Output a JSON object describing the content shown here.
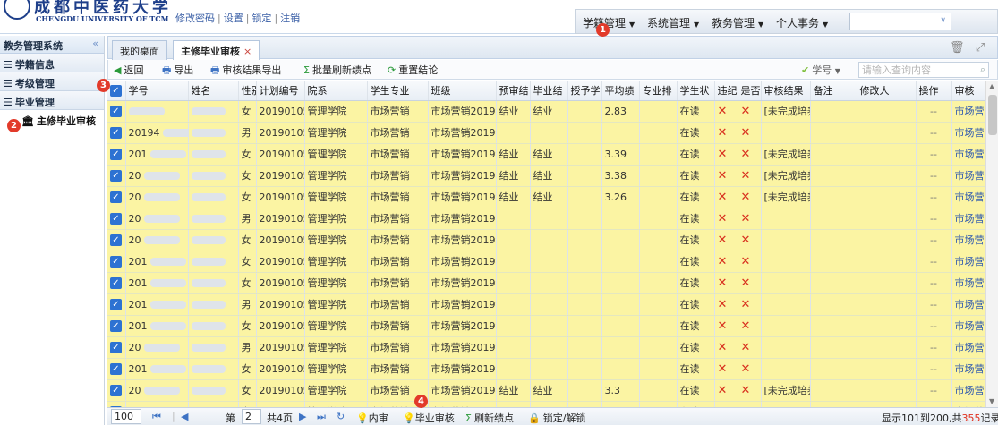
{
  "header": {
    "logo_cn": "成都中医药大学",
    "logo_en": "CHENGDU UNIVERSITY OF TCM",
    "links": [
      "修改密码",
      "设置",
      "锁定",
      "注销"
    ],
    "menu": [
      "学籍管理",
      "系统管理",
      "教务管理",
      "个人事务"
    ],
    "select_value": ""
  },
  "sidebar": {
    "title": "教务管理系统",
    "collapse": "«",
    "items": [
      {
        "label": "学籍信息"
      },
      {
        "label": "考级管理"
      },
      {
        "label": "毕业管理"
      }
    ],
    "sub_item": "主修毕业审核"
  },
  "tabs": {
    "home": "我的桌面",
    "active": "主修毕业审核",
    "close": "×"
  },
  "toolbar": {
    "back": "返回",
    "export": "导出",
    "export_results": "审核结果导出",
    "batch_refresh": "批量刷新绩点",
    "reset": "重置结论",
    "search_key": "学号",
    "search_placeholder": "请输入查询内容"
  },
  "columns": [
    "学号",
    "姓名",
    "性别",
    "计划编号",
    "院系",
    "学生专业",
    "班级",
    "预审结",
    "毕业结",
    "授予学",
    "平均绩",
    "专业排",
    "学生状",
    "违纪",
    "是否у",
    "审核结果",
    "备注",
    "修改人",
    "操作",
    "审核"
  ],
  "column_labels": [
    "学号",
    "姓名",
    "性别",
    "计划编号",
    "院系",
    "学生专业",
    "班级",
    "预审结",
    "毕业结",
    "授予学",
    "平均绩",
    "专业排",
    "学生状",
    "违纪",
    "是否",
    "审核结果",
    "备注",
    "修改人",
    "操作",
    "审核"
  ],
  "rows": [
    {
      "id": "",
      "gender": "女",
      "plan": "20190105",
      "dept": "管理学院",
      "major": "市场营销",
      "class": "市场营销2019级",
      "pre": "结业",
      "grad": "结业",
      "gpa": "2.83",
      "status": "在读",
      "result": "[未完成培养",
      "op": "--",
      "audit": "市场营"
    },
    {
      "id": "20194",
      "gender": "男",
      "plan": "20190105",
      "dept": "管理学院",
      "major": "市场营销",
      "class": "市场营销2019级",
      "pre": "",
      "grad": "",
      "gpa": "",
      "status": "在读",
      "result": "",
      "op": "--",
      "audit": "市场营"
    },
    {
      "id": "201",
      "gender": "女",
      "plan": "20190105",
      "dept": "管理学院",
      "major": "市场营销",
      "class": "市场营销2019级",
      "pre": "结业",
      "grad": "结业",
      "gpa": "3.39",
      "status": "在读",
      "result": "[未完成培养",
      "op": "--",
      "audit": "市场营"
    },
    {
      "id": "20",
      "gender": "女",
      "plan": "20190105",
      "dept": "管理学院",
      "major": "市场营销",
      "class": "市场营销2019级",
      "pre": "结业",
      "grad": "结业",
      "gpa": "3.38",
      "status": "在读",
      "result": "[未完成培养",
      "op": "--",
      "audit": "市场营"
    },
    {
      "id": "20",
      "gender": "女",
      "plan": "20190105",
      "dept": "管理学院",
      "major": "市场营销",
      "class": "市场营销2019级",
      "pre": "结业",
      "grad": "结业",
      "gpa": "3.26",
      "status": "在读",
      "result": "[未完成培养",
      "op": "--",
      "audit": "市场营"
    },
    {
      "id": "20",
      "gender": "男",
      "plan": "20190105",
      "dept": "管理学院",
      "major": "市场营销",
      "class": "市场营销2019级",
      "pre": "",
      "grad": "",
      "gpa": "",
      "status": "在读",
      "result": "",
      "op": "--",
      "audit": "市场营"
    },
    {
      "id": "20",
      "gender": "女",
      "plan": "20190105",
      "dept": "管理学院",
      "major": "市场营销",
      "class": "市场营销2019级",
      "pre": "",
      "grad": "",
      "gpa": "",
      "status": "在读",
      "result": "",
      "op": "--",
      "audit": "市场营"
    },
    {
      "id": "201",
      "gender": "女",
      "plan": "20190105",
      "dept": "管理学院",
      "major": "市场营销",
      "class": "市场营销2019级",
      "pre": "",
      "grad": "",
      "gpa": "",
      "status": "在读",
      "result": "",
      "op": "--",
      "audit": "市场营"
    },
    {
      "id": "201",
      "gender": "女",
      "plan": "20190105",
      "dept": "管理学院",
      "major": "市场营销",
      "class": "市场营销2019级",
      "pre": "",
      "grad": "",
      "gpa": "",
      "status": "在读",
      "result": "",
      "op": "--",
      "audit": "市场营"
    },
    {
      "id": "201",
      "gender": "男",
      "plan": "20190105",
      "dept": "管理学院",
      "major": "市场营销",
      "class": "市场营销2019级",
      "pre": "",
      "grad": "",
      "gpa": "",
      "status": "在读",
      "result": "",
      "op": "--",
      "audit": "市场营"
    },
    {
      "id": "201",
      "gender": "女",
      "plan": "20190105",
      "dept": "管理学院",
      "major": "市场营销",
      "class": "市场营销2019级",
      "pre": "",
      "grad": "",
      "gpa": "",
      "status": "在读",
      "result": "",
      "op": "--",
      "audit": "市场营"
    },
    {
      "id": "20",
      "gender": "男",
      "plan": "20190105",
      "dept": "管理学院",
      "major": "市场营销",
      "class": "市场营销2019级",
      "pre": "",
      "grad": "",
      "gpa": "",
      "status": "在读",
      "result": "",
      "op": "--",
      "audit": "市场营"
    },
    {
      "id": "201",
      "gender": "女",
      "plan": "20190105",
      "dept": "管理学院",
      "major": "市场营销",
      "class": "市场营销2019级",
      "pre": "",
      "grad": "",
      "gpa": "",
      "status": "在读",
      "result": "",
      "op": "--",
      "audit": "市场营"
    },
    {
      "id": "20",
      "gender": "女",
      "plan": "20190105",
      "dept": "管理学院",
      "major": "市场营销",
      "class": "市场营销2019级",
      "pre": "结业",
      "grad": "结业",
      "gpa": "3.3",
      "status": "在读",
      "result": "[未完成培养",
      "op": "--",
      "audit": "市场营"
    },
    {
      "id": "2019",
      "gender": "女",
      "plan": "20190105",
      "dept": "管理学院",
      "major": "市场营销",
      "class": "市场营销2019级",
      "pre": "",
      "grad": "",
      "gpa": "",
      "status": "在读",
      "result": "",
      "op": "--",
      "audit": "市场营"
    }
  ],
  "pager": {
    "page_size": "100",
    "page_label": "第",
    "page_value": "2",
    "total_pages": "共4页",
    "btn_neishen": "内审",
    "btn_grad_audit": "毕业审核",
    "btn_refresh_gpa": "刷新绩点",
    "btn_lock": "锁定/解锁",
    "summary_prefix": "显示101到200,共",
    "summary_total": "355",
    "summary_suffix": "记录"
  },
  "badges": [
    "1",
    "2",
    "3",
    "4"
  ],
  "colors": {
    "row_bg": "#fbf4a3",
    "accent": "#2d72d2",
    "badge": "#e23a2a",
    "link": "#2a55b0",
    "red_x": "#d8301f"
  }
}
